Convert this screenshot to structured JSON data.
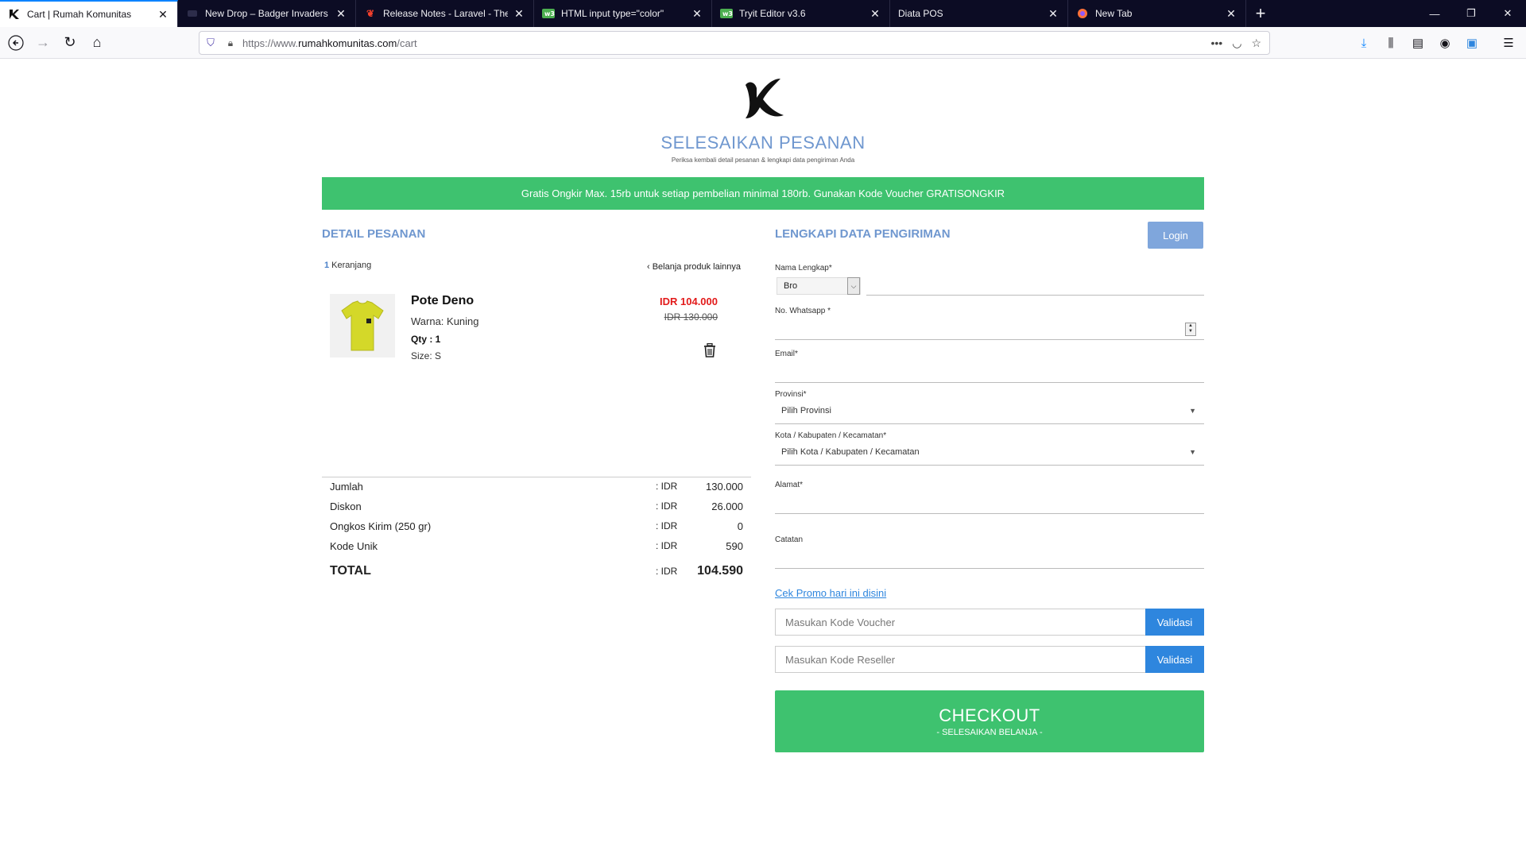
{
  "browser": {
    "tabs": [
      {
        "title": "Cart | Rumah Komunitas",
        "icon": "k-logo-icon",
        "active": true
      },
      {
        "title": "New Drop – Badger Invaders",
        "icon": "site-icon",
        "active": false
      },
      {
        "title": "Release Notes - Laravel - The PHP",
        "icon": "laravel-icon",
        "active": false
      },
      {
        "title": "HTML input type=\"color\"",
        "icon": "w3-icon",
        "active": false
      },
      {
        "title": "Tryit Editor v3.6",
        "icon": "w3-icon",
        "active": false
      },
      {
        "title": "Diata POS",
        "icon": "",
        "active": false
      },
      {
        "title": "New Tab",
        "icon": "firefox-icon",
        "active": false
      }
    ],
    "url_prefix": "https://www.",
    "url_domain": "rumahkomunitas.com",
    "url_path": "/cart"
  },
  "header": {
    "title": "SELESAIKAN PESANAN",
    "subtitle": "Periksa kembali detail pesanan & lengkapi data pengiriman Anda"
  },
  "banner": {
    "text": "Gratis Ongkir Max. 15rb untuk setiap pembelian minimal 180rb. Gunakan Kode Voucher GRATISONGKIR",
    "color": "#3ec26f"
  },
  "order": {
    "section_title": "DETAIL PESANAN",
    "cart_count": "1",
    "cart_label": "Keranjang",
    "continue_link": "‹ Belanja produk lainnya",
    "item": {
      "name": "Pote Deno",
      "color": "Warna: Kuning",
      "qty": "Qty : 1",
      "size": "Size: S",
      "price": "IDR 104.000",
      "old_price": "IDR 130.000"
    },
    "summary": [
      {
        "label": "Jumlah",
        "currency": ": IDR",
        "value": "130.000"
      },
      {
        "label": "Diskon",
        "currency": ": IDR",
        "value": "26.000"
      },
      {
        "label": "Ongkos Kirim (250 gr)",
        "currency": ": IDR",
        "value": "0"
      },
      {
        "label": "Kode Unik",
        "currency": ": IDR",
        "value": "590"
      }
    ],
    "total": {
      "label": "TOTAL",
      "currency": ": IDR",
      "value": "104.590"
    }
  },
  "shipping": {
    "section_title": "LENGKAPI DATA PENGIRIMAN",
    "login_label": "Login",
    "name_label": "Nama Lengkap*",
    "title_value": "Bro",
    "whatsapp_label": "No. Whatsapp *",
    "email_label": "Email*",
    "province_label": "Provinsi*",
    "province_value": "Pilih Provinsi",
    "city_label": "Kota / Kabupaten / Kecamatan*",
    "city_value": "Pilih Kota / Kabupaten / Kecamatan",
    "address_label": "Alamat*",
    "notes_label": "Catatan",
    "promo_link": "Cek Promo hari ini disini",
    "voucher_placeholder": "Masukan Kode Voucher",
    "reseller_placeholder": "Masukan Kode Reseller",
    "validate_label": "Validasi",
    "checkout_label": "CHECKOUT",
    "checkout_sub": "- SELESAIKAN BELANJA -"
  },
  "colors": {
    "accent_blue": "#6f97cf",
    "button_blue": "#2e86de",
    "green": "#3ec26f",
    "price_red": "#e21a1a"
  }
}
